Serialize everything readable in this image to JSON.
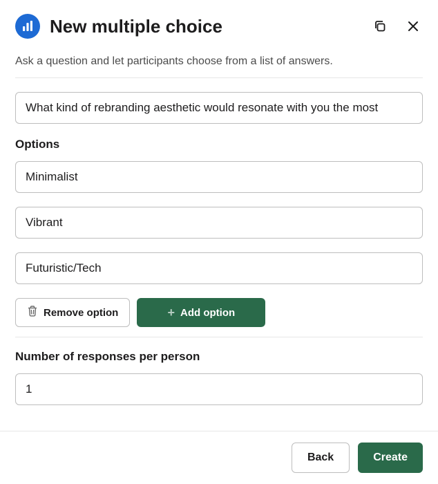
{
  "header": {
    "title": "New multiple choice"
  },
  "description": "Ask a question and let participants choose from a list of answers.",
  "question": {
    "value": "What kind of rebranding aesthetic would resonate with you the most"
  },
  "options_label": "Options",
  "options": [
    {
      "value": "Minimalist"
    },
    {
      "value": "Vibrant"
    },
    {
      "value": "Futuristic/Tech"
    }
  ],
  "option_actions": {
    "remove_label": "Remove option",
    "add_label": "Add option"
  },
  "responses": {
    "label": "Number of responses per person",
    "value": "1"
  },
  "footer": {
    "back_label": "Back",
    "create_label": "Create"
  }
}
